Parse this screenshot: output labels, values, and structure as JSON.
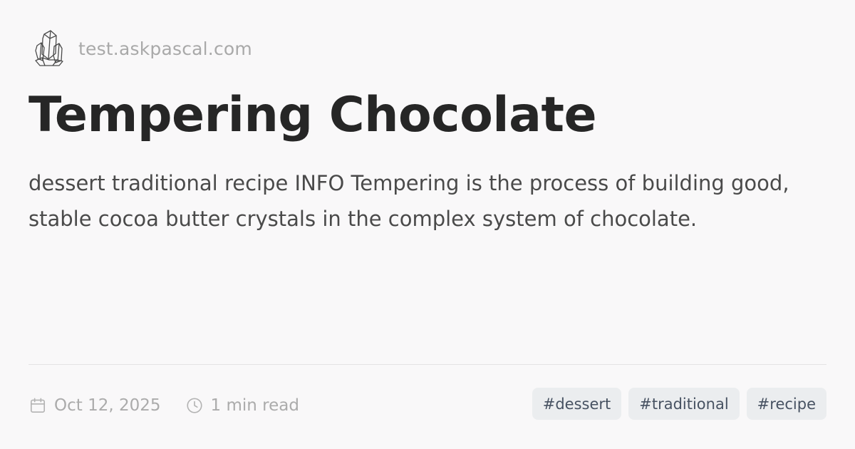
{
  "site": {
    "domain": "test.askpascal.com",
    "logo_icon": "crystal-cluster-icon"
  },
  "article": {
    "title": "Tempering Chocolate",
    "description": "dessert traditional recipe INFO Tempering is the process of building good, stable cocoa butter crystals in the complex system of chocolate.",
    "date": "Oct 12, 2025",
    "read_time": "1 min read",
    "date_icon": "calendar-icon",
    "read_time_icon": "clock-icon",
    "tags": [
      "#dessert",
      "#traditional",
      "#recipe"
    ]
  },
  "colors": {
    "background": "#f9f8f9",
    "title": "#262626",
    "muted_text": "#a9a9a9",
    "tag_background": "#ebedef",
    "tag_text": "#475262"
  }
}
